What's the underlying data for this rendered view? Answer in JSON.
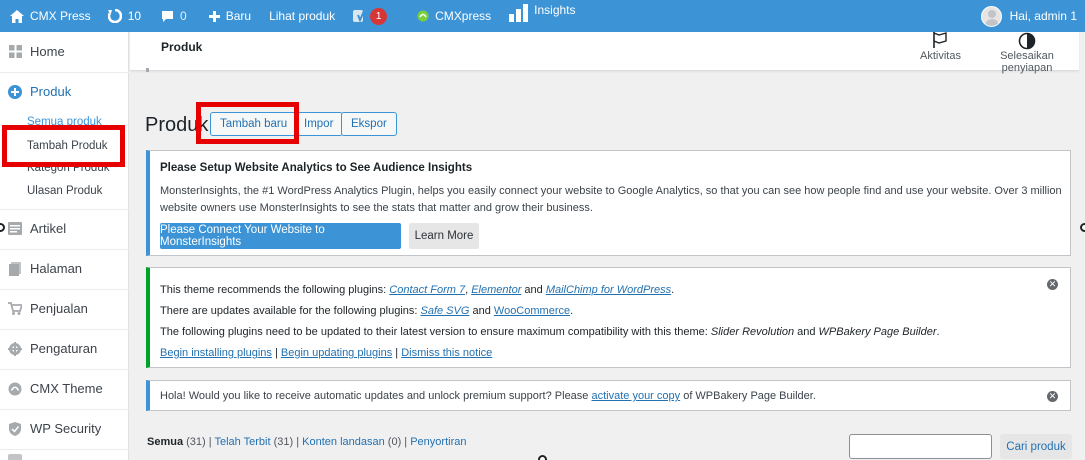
{
  "adminbar": {
    "site_name": "CMX Press",
    "updates_count": "10",
    "comments_count": "0",
    "new_label": "Baru",
    "view_label": "Lihat produk",
    "yoast_badge": "1",
    "cmxpress_label": "CMXpress",
    "insights_label": "Insights",
    "greeting": "Hai, admin 1",
    "bar_color": "#3c94d6"
  },
  "sidebar": {
    "items": [
      {
        "label": "Home",
        "icon": "dashboard-icon"
      },
      {
        "label": "Produk",
        "icon": "plus-circle-icon"
      },
      {
        "label": "Artikel",
        "icon": "post-icon"
      },
      {
        "label": "Halaman",
        "icon": "page-icon"
      },
      {
        "label": "Penjualan",
        "icon": "cart-icon"
      },
      {
        "label": "Pengaturan",
        "icon": "gear-icon"
      },
      {
        "label": "CMX Theme",
        "icon": "cmx-icon"
      },
      {
        "label": "WP Security",
        "icon": "shield-icon"
      }
    ],
    "submenu": [
      "Semua produk",
      "Tambah Produk",
      "Kategori Produk",
      "Ulasan Produk"
    ]
  },
  "topbar": {
    "title": "Produk",
    "activity_label": "Aktivitas",
    "finish_setup_label": "Selesaikan penyiapan"
  },
  "page": {
    "title": "Produk",
    "add_new_label": "Tambah baru",
    "import_label": "Impor",
    "export_label": "Ekspor"
  },
  "notice_insights": {
    "heading": "Please Setup Website Analytics to See Audience Insights",
    "body": "MonsterInsights, the #1 WordPress Analytics Plugin, helps you easily connect your website to Google Analytics, so that you can see how people find and use your website. Over 3 million website owners use MonsterInsights to see the stats that matter and grow their business.",
    "connect_label": "Please Connect Your Website to MonsterInsights",
    "learn_more_label": "Learn More"
  },
  "notice_plugins": {
    "line1_prefix": "This theme recommends the following plugins: ",
    "plugin_cf7": "Contact Form 7",
    "sep1": ", ",
    "plugin_elementor": "Elementor",
    "and1": " and ",
    "plugin_mailchimp": "MailChimp for WordPress",
    "end1": ".",
    "line2_prefix": "There are updates available for the following plugins: ",
    "plugin_safesvg": "Safe SVG",
    "and2": " and ",
    "plugin_woo": "WooCommerce",
    "end2": ".",
    "line3_prefix": "The following plugins need to be updated to their latest version to ensure maximum compatibility with this theme: ",
    "plugin_slider": "Slider Revolution",
    "and3": " and ",
    "plugin_wpbakery": "WPBakery Page Builder",
    "end3": ".",
    "begin_installing": "Begin installing plugins",
    "pipe1": " | ",
    "begin_updating": "Begin updating plugins",
    "pipe2": " | ",
    "dismiss_notice": "Dismiss this notice"
  },
  "notice_wpbakery": {
    "prefix": "Hola! Would you like to receive automatic updates and unlock premium support? Please ",
    "link": "activate your copy",
    "suffix": " of WPBakery Page Builder."
  },
  "filters": {
    "all_label": "Semua",
    "all_count": " (31)",
    "pipe": " | ",
    "published_label": "Telah Terbit",
    "published_count": " (31)",
    "drafts_label": "Konten landasan",
    "drafts_count": " (0)",
    "sort_label": "Penyortiran"
  },
  "search": {
    "button_label": "Cari produk",
    "placeholder": ""
  }
}
